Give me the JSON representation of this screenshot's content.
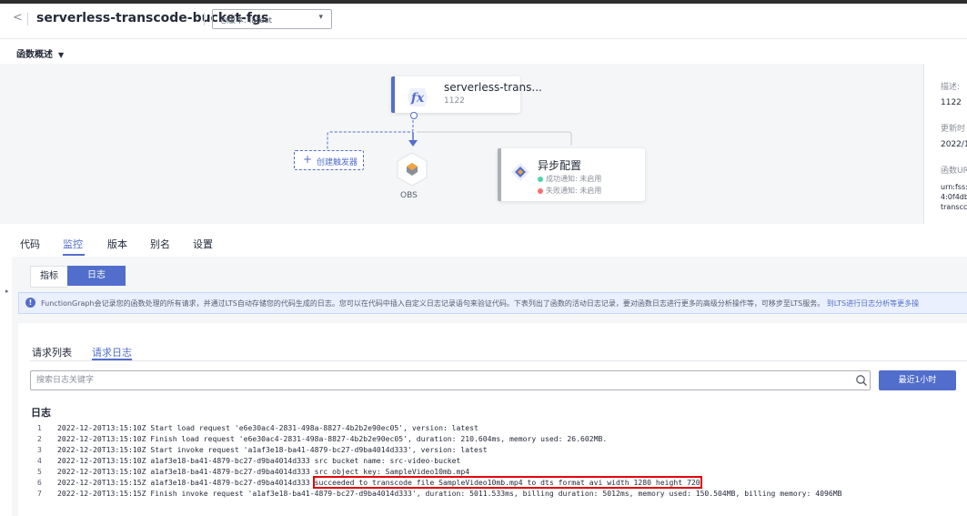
{
  "header": {
    "back_icon": "chevron-left-icon",
    "function_name": "serverless-transcode-bucket-fgs",
    "version_select_value": "◎版本: latest"
  },
  "overview": {
    "label": "函数概述"
  },
  "flow": {
    "function_node_name": "serverless-trans...",
    "function_node_sub": "1122",
    "create_trigger_label": "创建触发器",
    "obs_label": "OBS",
    "async_title": "异步配置",
    "async_success": "成功通知: 未启用",
    "async_failure": "失败通知: 未启用"
  },
  "sidepanel": {
    "desc_label": "描述:",
    "desc_value": "1122",
    "updated_label": "更新时",
    "updated_value": "2022/1",
    "urn_label": "函数UR",
    "urn_value_1": "urn:fss:",
    "urn_value_2": "4:0f4db",
    "urn_value_3": "transcc"
  },
  "tabs": [
    "代码",
    "监控",
    "版本",
    "别名",
    "设置"
  ],
  "monitor": {
    "seg_metric": "指标",
    "seg_log": "日志",
    "info_text": "FunctionGraph会记录您的函数处理的所有请求，并通过LTS自动存储您的代码生成的日志。您可以在代码中插入自定义日志记录语句来验证代码。下表列出了函数的活动日志记录，要对函数日志进行更多的高级分析操作等，可移步至LTS服务。",
    "info_link": "到LTS进行日志分析等更多操",
    "subtabs": [
      "请求列表",
      "请求日志"
    ],
    "search_placeholder": "搜索日志关键字",
    "time_button": "最近1小时",
    "log_title": "日志"
  },
  "logs": [
    {
      "n": "1",
      "text": "2022-12-20T13:15:10Z Start load request 'e6e30ac4-2831-498a-8827-4b2b2e90ec05', version: latest"
    },
    {
      "n": "2",
      "text": "2022-12-20T13:15:10Z Finish load request 'e6e30ac4-2831-498a-8827-4b2b2e90ec05', duration: 210.604ms, memory used: 26.602MB."
    },
    {
      "n": "3",
      "text": "2022-12-20T13:15:10Z Start invoke request 'a1af3e18-ba41-4879-bc27-d9ba4014d333', version: latest"
    },
    {
      "n": "4",
      "text": "2022-12-20T13:15:10Z a1af3e18-ba41-4879-bc27-d9ba4014d333 src bucket name: src-video-bucket"
    },
    {
      "n": "5",
      "text": "2022-12-20T13:15:10Z a1af3e18-ba41-4879-bc27-d9ba4014d333 src object key: SampleVideo10mb.mp4"
    },
    {
      "n": "6",
      "text": "2022-12-20T13:15:15Z a1af3e18-ba41-4879-bc27-d9ba4014d333 ",
      "highlight": "succeeded to transcode file SampleVideo10mb.mp4 to dts format avi width 1280 height 720"
    },
    {
      "n": "7",
      "text": "2022-12-20T13:15:15Z Finish invoke request 'a1af3e18-ba41-4879-bc27-d9ba4014d333', duration: 5011.533ms, billing duration: 5012ms, memory used: 150.504MB, billing memory: 4096MB"
    }
  ],
  "colors": {
    "accent": "#526ecc",
    "success_dot": "#50d4ab",
    "failure_dot": "#f66f6a",
    "highlight_border": "#e3000b"
  }
}
